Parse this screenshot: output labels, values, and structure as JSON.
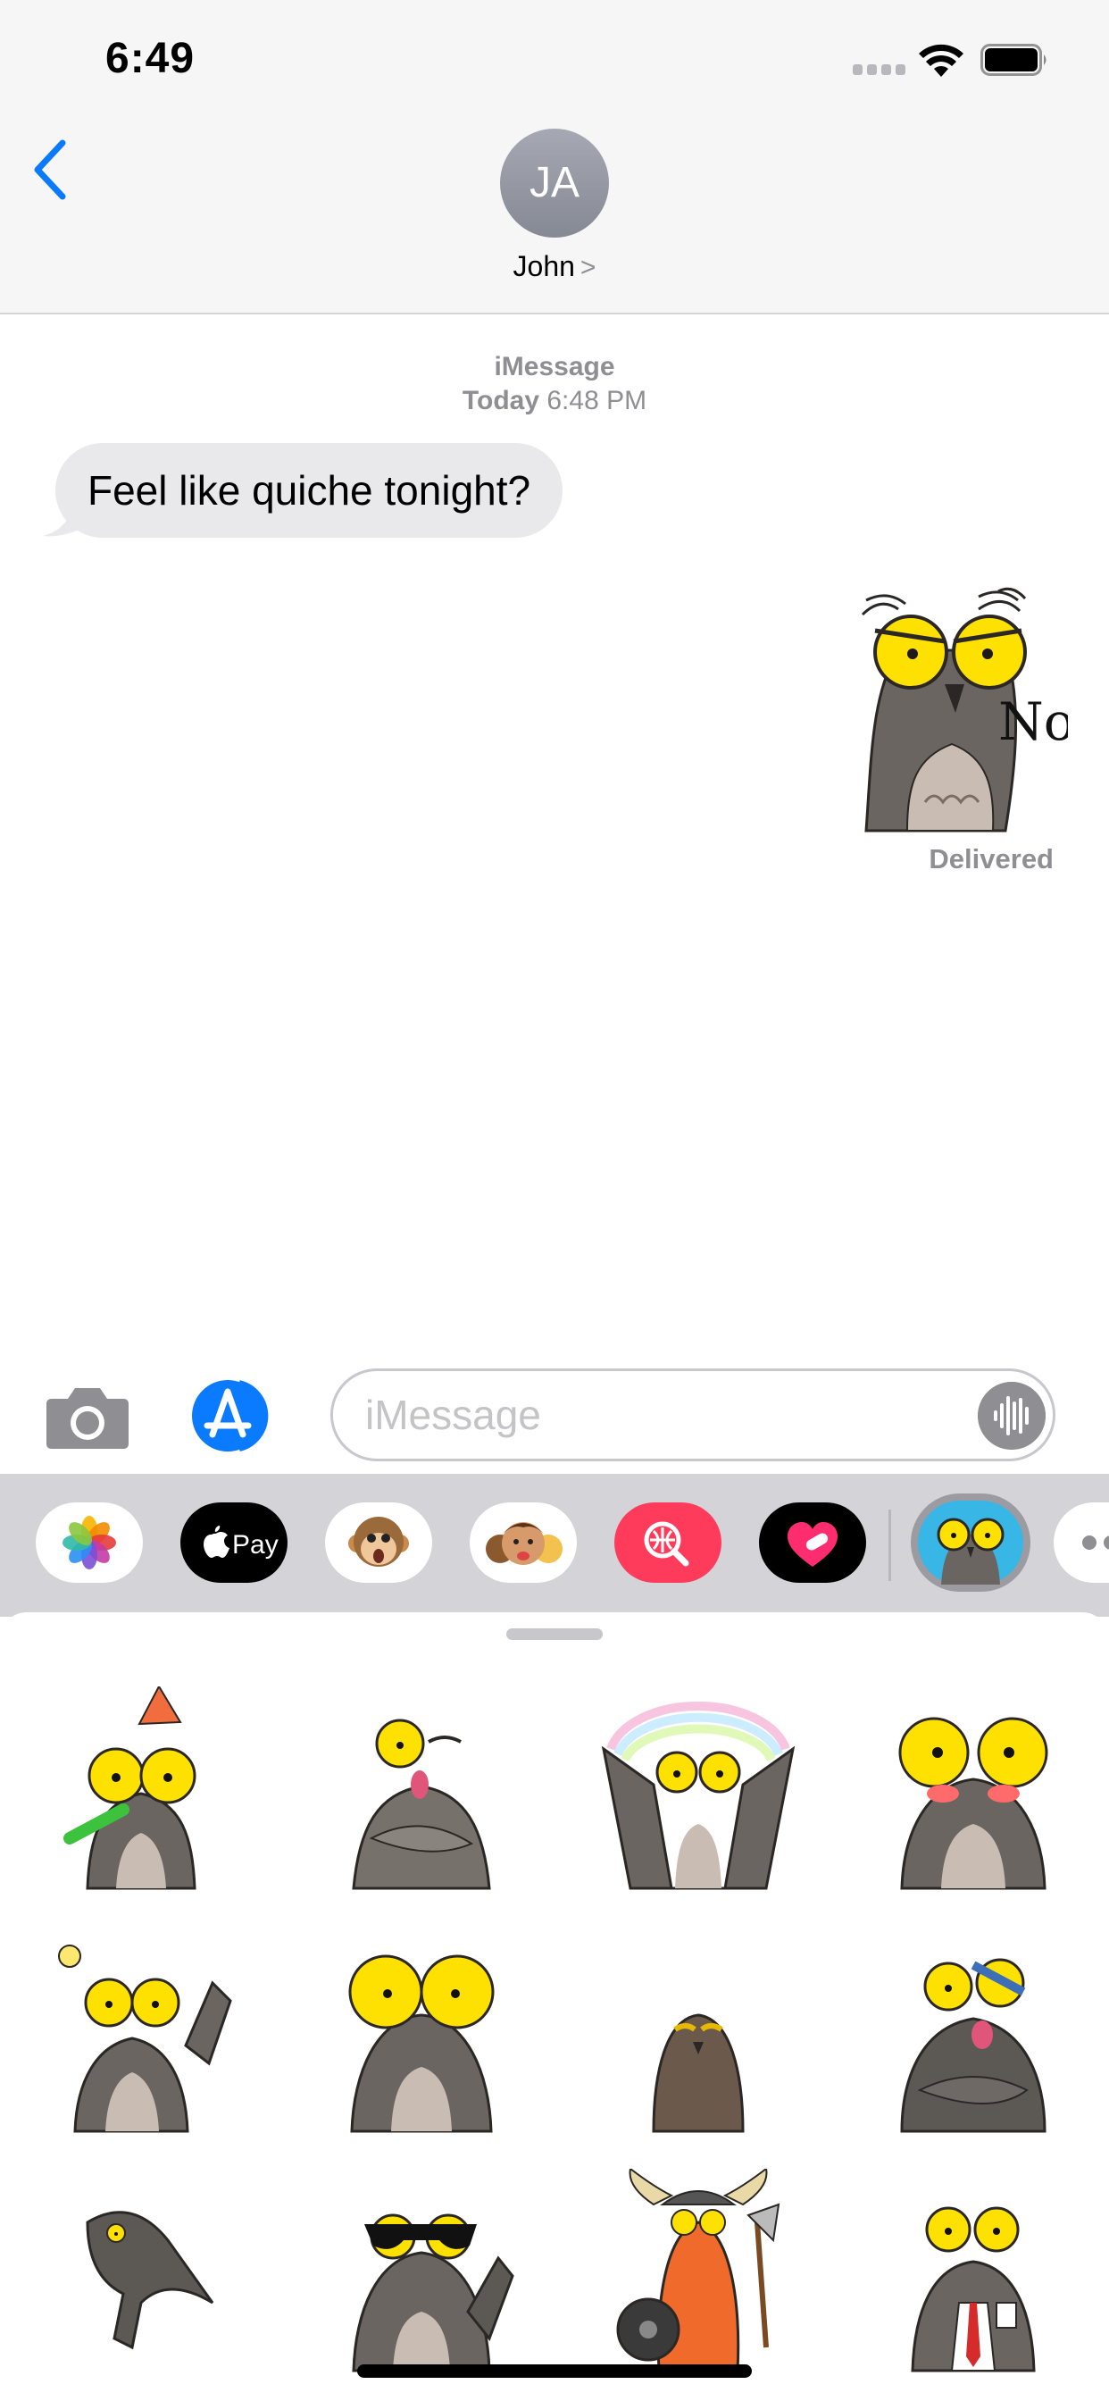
{
  "status_bar": {
    "time": "6:49"
  },
  "header": {
    "avatar_initials": "JA",
    "contact_name": "John",
    "chevron": ">"
  },
  "conversation": {
    "service": "iMessage",
    "day": "Today",
    "time": "6:48 PM",
    "incoming_message": "Feel like quiche tonight?",
    "sent_sticker_text": "No",
    "delivery_status": "Delivered"
  },
  "compose": {
    "placeholder": "iMessage"
  },
  "app_drawer": {
    "apps": [
      "photos-app",
      "apple-pay-app",
      "animoji-app",
      "memoji-app",
      "image-search-app",
      "digital-touch-app",
      "potoo-sticker-app",
      "more-apps"
    ],
    "apple_pay_label": "Pay"
  },
  "sticker_panel": {
    "stickers": [
      "party-owl",
      "winking-owl",
      "rainbow-owl",
      "blushing-owl",
      "idea-owl",
      "wide-eyed-owl",
      "sleepy-owl",
      "shocked-owl",
      "flying-owl",
      "cool-sunglasses-owl",
      "viking-owl",
      "office-owl"
    ]
  },
  "colors": {
    "accent": "#0a7aff",
    "bubble_gray": "#e9e9eb",
    "owl_eye": "#ffe100",
    "owl_body": "#6a6560"
  }
}
